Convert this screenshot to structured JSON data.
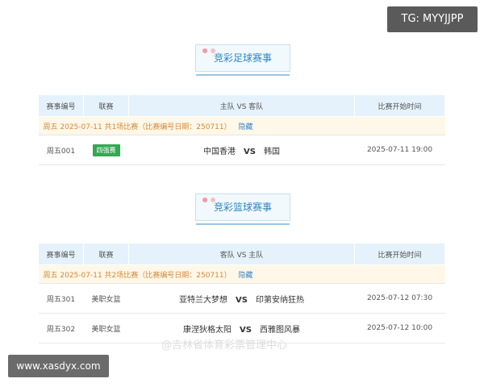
{
  "watermark_tg": "TG: MYYJJPP",
  "watermark_site": "www.xasdyx.com",
  "weibo_watermark": "@吉林省体育彩票管理中心",
  "football": {
    "title": "竞彩足球赛事",
    "headers": [
      "赛事编号",
      "联赛",
      "主队 VS 客队",
      "比赛开始时间"
    ],
    "date_row": "周五 2025-07-11 共1场比赛（比赛编号日期：250711）",
    "hide_link": "隐藏",
    "matches": [
      {
        "id": "周五001",
        "league": "四强赛",
        "home": "中国香港",
        "vs": "VS",
        "away": "韩国",
        "time": "2025-07-11 19:00"
      }
    ]
  },
  "basketball": {
    "title": "竞彩篮球赛事",
    "headers": [
      "赛事编号",
      "联赛",
      "客队 VS 主队",
      "比赛开始时间"
    ],
    "date_row": "周五 2025-07-11 共2场比赛（比赛编号日期：250711）",
    "hide_link": "隐藏",
    "matches": [
      {
        "id": "周五301",
        "league": "美职女篮",
        "home": "亚特兰大梦想",
        "vs": "VS",
        "away": "印第安纳狂热",
        "time": "2025-07-12 07:30"
      },
      {
        "id": "周五302",
        "league": "美职女篮",
        "home": "康涅狄格太阳",
        "vs": "VS",
        "away": "西雅图风暴",
        "time": "2025-07-12 10:00"
      }
    ]
  },
  "colors": {
    "badge_green": "#34a853",
    "header_bg": "#e5f2fb",
    "date_row_bg": "#fff7e8",
    "title_blue": "#2d86c2"
  }
}
